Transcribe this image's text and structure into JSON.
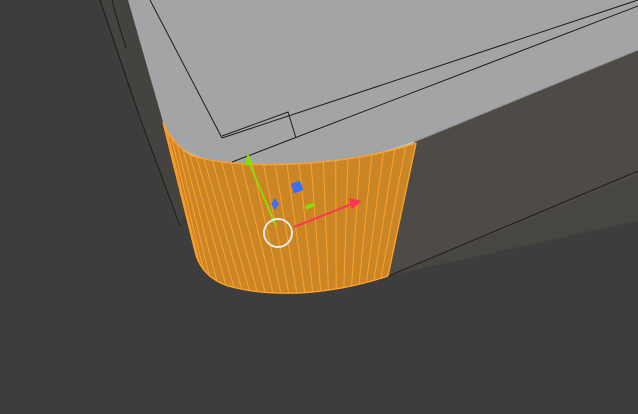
{
  "viewport": {
    "background_color": "#3d3d3d",
    "mode": "edit-mode-face-select",
    "mesh": {
      "top_face_color": "#a3a4a5",
      "top_edge_highlight_color": "#b8b9ba",
      "side_face_color": "#4e4b47",
      "side_dark_color": "#3f3c39",
      "wire_color": "#1c1c1c",
      "selected_face_color": "#c98526",
      "selected_edge_color": "#ffa12b",
      "selected_face_count": 1,
      "selected_loop_segments": 26
    },
    "gizmo": {
      "type": "move-gizmo",
      "x_axis_color": "#ff3352",
      "y_axis_color": "#8bdc00",
      "z_axis_color": "#3d6ff0",
      "center_ring_color": "#e8e8e8",
      "icons": [
        "x-arrow-icon",
        "y-arrow-icon",
        "z-plane-handle-icon",
        "center-ring-icon"
      ]
    }
  }
}
